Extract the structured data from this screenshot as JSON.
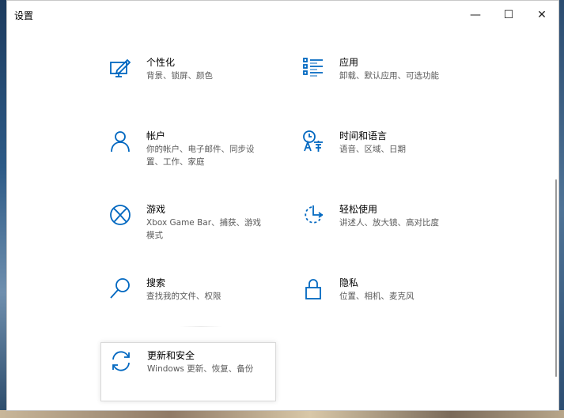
{
  "window": {
    "title": "设置",
    "controls": {
      "minimize": "—",
      "maximize": "☐",
      "close": "✕"
    }
  },
  "accent": "#0067c0",
  "tiles": [
    {
      "name": "个性化",
      "desc": "背景、锁屏、颜色",
      "icon": "personalization-icon"
    },
    {
      "name": "应用",
      "desc": "卸载、默认应用、可选功能",
      "icon": "apps-icon"
    },
    {
      "name": "帐户",
      "desc": "你的帐户、电子邮件、同步设置、工作、家庭",
      "icon": "accounts-icon"
    },
    {
      "name": "时间和语言",
      "desc": "语音、区域、日期",
      "icon": "time-language-icon"
    },
    {
      "name": "游戏",
      "desc": "Xbox Game Bar、捕获、游戏模式",
      "icon": "xbox-icon"
    },
    {
      "name": "轻松使用",
      "desc": "讲述人、放大镜、高对比度",
      "icon": "ease-of-access-icon"
    },
    {
      "name": "搜索",
      "desc": "查找我的文件、权限",
      "icon": "search-icon"
    },
    {
      "name": "隐私",
      "desc": "位置、相机、麦克风",
      "icon": "lock-icon"
    },
    {
      "name": "更新和安全",
      "desc": "Windows 更新、恢复、备份",
      "icon": "sync-icon"
    }
  ]
}
